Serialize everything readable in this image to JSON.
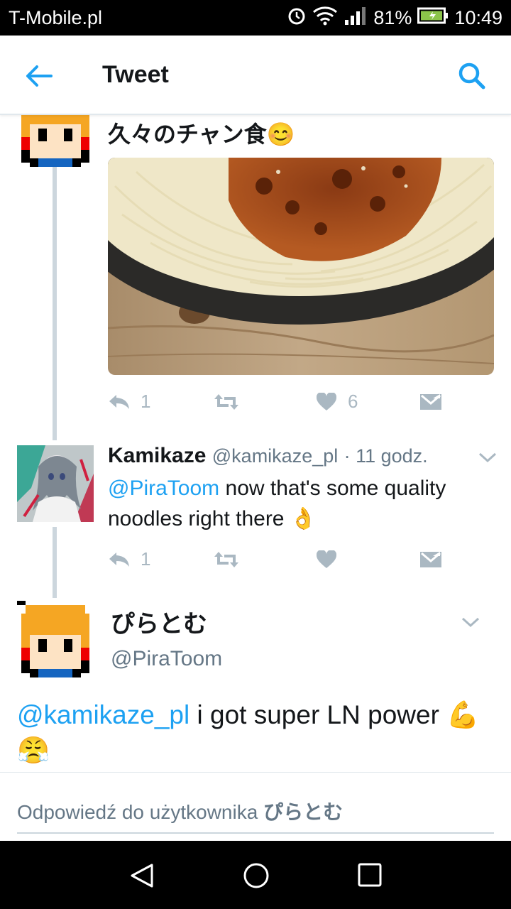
{
  "status_bar": {
    "carrier": "T-Mobile.pl",
    "battery": "81%",
    "time": "10:49"
  },
  "app_bar": {
    "title": "Tweet"
  },
  "tweets": [
    {
      "text": "久々のチャン食",
      "emoji": "😊",
      "image_alt": "spaghetti",
      "actions": {
        "reply_count": "1",
        "retweet_count": "",
        "like_count": "6"
      }
    },
    {
      "name": "Kamikaze",
      "handle": "@kamikaze_pl",
      "time": "· 11 godz.",
      "mention": "@PiraToom",
      "text": " now that's some quality noodles right there",
      "emoji": "👌",
      "actions": {
        "reply_count": "1",
        "retweet_count": "",
        "like_count": ""
      }
    }
  ],
  "focused_tweet": {
    "name": "ぴらとむ",
    "handle": "@PiraToom",
    "mention": "@kamikaze_pl",
    "text": " i got super LN power",
    "emoji": "💪😤"
  },
  "reply": {
    "placeholder_prefix": "Odpowiedź do użytkownika",
    "placeholder_name": "ぴらとむ"
  },
  "colors": {
    "accent": "#1da1f2",
    "icon_gray": "#aab8c2",
    "line": "#ccd6dd"
  }
}
